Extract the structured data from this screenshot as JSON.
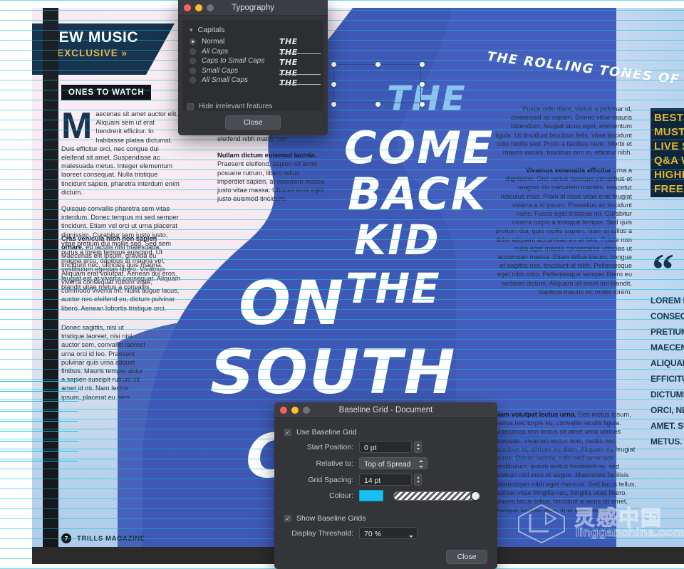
{
  "document": {
    "masthead": {
      "title": "NEW MUSIC",
      "subtitle": "« EXCLUSIVE »"
    },
    "section_tag": "ONES TO WATCH",
    "script_headline": "THE ROLLING TONES OF CBK SEND V",
    "headline_words": {
      "the_small": "THE",
      "come": "COME",
      "back": "BACK",
      "kid": "KID",
      "the": "THE",
      "on": "ON",
      "south": "SOUTH",
      "co": "CO"
    },
    "columns": {
      "col1": "Maecenas sit amet auctor elit. Aliquam sem ut erat hendrerit efficitur. In habitasse platea dictumst. Duis efficitur orci, nec congue dui eleifend sit amet. Suspendisse ac malesuada metus. Integer elementum laoreet consequat. Nulla tristique tincidunt sapien, pharetra interdum enim dictum.",
      "col1_p2": "Quisque convallis pharetra sem vitae interdum. Donec tempus mi sed semper tincidunt. Etiam vel orci ut urna placerat dignissim. Curabitur sem justo justo, vitae pretium dui mollis sed. Sed sem purus a lorem tempus euismod. Ut magna arcu, dapibus at magna vel, vestibulum egestas libero. Vivamus feugiat est at viverra consequat. Aliquam blandit vitae metus a convallis.",
      "col1_p3_bold": "Cras vehicula nibh non sapien ornare,",
      "col1_p3": " eu iaculis nisi malesuada. Maecenas elit ipsum, gravida eu tincidunt nec, ultricies quis magna. Aliquam erat volutpat. Aenean dui eros, viverra consequat rutrum vitae, commodo viverra mi. Nulla augue lacus, auctor nec eleifend eu, dictum pulvinar libero. Aenean lobortis tristique orci.",
      "col1_p4": "Donec sagittis, nisi ut tristique laoreet, nisi nisl auctor sem, convallis laoreet urna orci id leo. Praesent pulvinar quis urna aliquet finibus. Mauris tempor dolor a sapien suscipit rutrum sit amet id mi. Nam lectus ipsum, placerat eu sem",
      "col2_top": "eleifend nibh mattis non.",
      "col2_bold": "Nullam dictum euismod lacinia.",
      "col2": " Praesent eleifend, sapien sit amet posuere rutrum, libero tellus imperdiet sapien, at hendrerit massa justo vitae massa. Ultrices eros eget justo euismod tincidunt.",
      "col3": "Fusce odio diam, varius a pulvinar id, consequat ac sapien. Donec vitae mauris bibendum, feugiat lacus eget, elementum ligula. Ut tincidunt faucibus felis, vitae tincidunt odio mollis sed. Proin a facilisis nunc. Morbi et mauris iaculis, faucibus orci in, efficitur nibh.",
      "col3b_bold": "Vivamus venenatis efficitur",
      "col3b": " urna a dignissim. Orci varius natoque penatibus et magnis dis parturient montes, nascetur ridiculus mus. Proin id risus vitae erat feugiat viverra a id ipsum. Phasellus ac tincidunt nunc. Fusce eget tristique mi. Curabitur viverra turpis a tristique tempor. Sed quis pretium dui, quis mollis sapien. Nam ut tellus a dolor aliquam accumsan eu et felis. Fusce non nulla eget massa consectetur ultricies ut accumsan massa. Etiam tellus ipsum, congue et sagittis nec, tincidunt id nibh. Pellentesque eget nibh odio. Pellentesque semper libero eu sodales dictum. Aliquam sit amet dui blandit, dapibus mauris et, mollis lorem.",
      "col4_bold": "Nam volutpat lectus urna.",
      "col4": " Sed metus ipsum, varius nec turpis eu, convallis iaculis ligula. Maecenas non lectus sit amet urna ultrices molestie. Vivamus lectus felis, mattis nec faucibus id, ultrices eu diam. Aliquam eu feugiat purus. Donec lacinia, odio sed venenatis vestibulum, ipsum metus hendrerit mi, sed pretium nisl eros et augue. Maecenas facilisis ullamcorper nibh eget rhoncus. Sed lacus tellus, laoreet vitae fringilla nec, fringilla vitae libero. Mauris lacus tellus, tincidunt a lacus sit amet, tristique facilisis arcu. In et sem neque."
    },
    "yellow_list": [
      "BEST NEW ART",
      "MUST LISTEN T",
      "LIVE SHOWS",
      "Q&A WITH BIG",
      "HIGHLIGHTS",
      "FREE TICKETS"
    ],
    "pull_quote_mark": "“",
    "pull_quote_lines": [
      "LOREM IPSUM DOLOR",
      "CONSECTETUR ADIPIS",
      "PRETIUM TINCIDUNT D",
      "MAECENAS SIT AMET",
      "ALIQUAM ET SEM UT E",
      "EFFICITUR. IN HAC HA",
      "DICTUMST. DUIS LAOR",
      "ORCI, NEC CONGUE DU",
      "AMET. SUSPENDISSE A",
      "METUS. INTEGER ELEM"
    ],
    "footer": {
      "page_number": "7",
      "publication": "TRILLS MAGAZINE"
    },
    "watermark": {
      "text": "灵感中国",
      "domain": "lingganchina.com"
    }
  },
  "typography_window": {
    "title": "Typography",
    "group_label": "Capitals",
    "chevron": "chevron-down",
    "options": [
      {
        "label": "Normal",
        "selected": true,
        "sample": "THE",
        "struck": false
      },
      {
        "label": "All Caps",
        "selected": false,
        "sample": "THE",
        "struck": true
      },
      {
        "label": "Caps to Small Caps",
        "selected": false,
        "sample": "THE",
        "struck": false
      },
      {
        "label": "Small Caps",
        "selected": false,
        "sample": "THE",
        "struck": true
      },
      {
        "label": "All Small Caps",
        "selected": false,
        "sample": "THE",
        "struck": true
      }
    ],
    "hide_irrelevant_label": "Hide irrelevant features",
    "hide_irrelevant_checked": false,
    "close_label": "Close"
  },
  "baseline_window": {
    "title": "Baseline Grid - Document",
    "use_baseline_grid": {
      "label": "Use Baseline Grid",
      "checked": true
    },
    "fields": [
      {
        "label": "Start Position:",
        "value": "0 pt",
        "control": "stepper"
      },
      {
        "label": "Relative to:",
        "value": "Top of Spread",
        "control": "popup"
      },
      {
        "label": "Grid Spacing:",
        "value": "14 pt",
        "control": "stepper"
      }
    ],
    "colour": {
      "label": "Colour:",
      "hex": "#17c0f0"
    },
    "show_baseline_grids": {
      "label": "Show Baseline Grids",
      "checked": true
    },
    "display_threshold": {
      "label": "Display Threshold:",
      "value": "70 %"
    },
    "close_label": "Close"
  },
  "theme": {
    "accent_cyan": "#17c0f0",
    "brand_navy": "#17334d",
    "brand_yellow": "#e8b52e",
    "headline_blue": "#3f58b5",
    "selection_blue": "#2a4b8d"
  }
}
